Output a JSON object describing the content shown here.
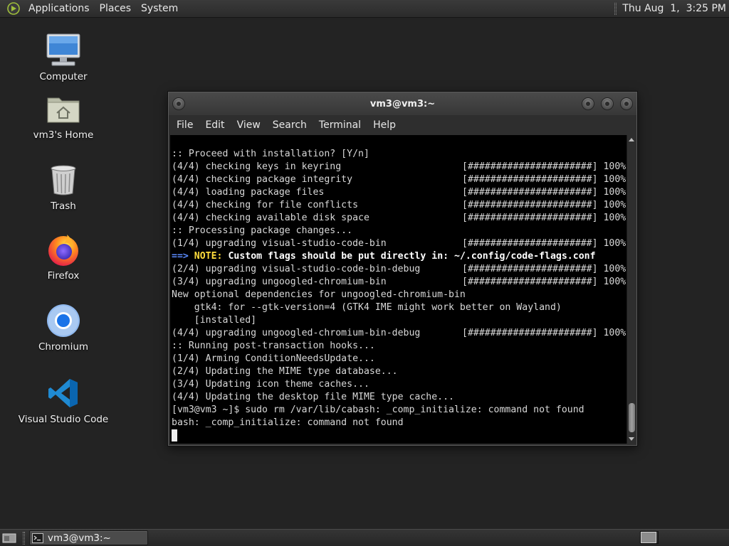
{
  "top_panel": {
    "menus": [
      "Applications",
      "Places",
      "System"
    ],
    "clock": "Thu Aug  1,  3:25 PM"
  },
  "desktop_icons": [
    {
      "label": "Computer",
      "icon": "computer-icon"
    },
    {
      "label": "vm3's Home",
      "icon": "home-folder-icon"
    },
    {
      "label": "Trash",
      "icon": "trash-icon"
    },
    {
      "label": "Firefox",
      "icon": "firefox-icon"
    },
    {
      "label": "Chromium",
      "icon": "chromium-icon"
    },
    {
      "label": "Visual Studio Code",
      "icon": "vscode-icon"
    }
  ],
  "terminal": {
    "title": "vm3@vm3:~",
    "menu": [
      "File",
      "Edit",
      "View",
      "Search",
      "Terminal",
      "Help"
    ],
    "progress_bar": "[######################] 100%",
    "lines": {
      "l01": ":: Proceed with installation? [Y/n]",
      "l02": "(4/4) checking keys in keyring",
      "l03": "(4/4) checking package integrity",
      "l04": "(4/4) loading package files",
      "l05": "(4/4) checking for file conflicts",
      "l06": "(4/4) checking available disk space",
      "l07": ":: Processing package changes...",
      "l08": "(1/4) upgrading visual-studio-code-bin",
      "l09_arrow": "==>",
      "l09_note": "NOTE:",
      "l09_msg": "Custom flags should be put directly in: ~/.config/code-flags.conf",
      "l10": "(2/4) upgrading visual-studio-code-bin-debug",
      "l11": "(3/4) upgrading ungoogled-chromium-bin",
      "l12": "New optional dependencies for ungoogled-chromium-bin",
      "l13": "    gtk4: for --gtk-version=4 (GTK4 IME might work better on Wayland)",
      "l14": "    [installed]",
      "l15": "(4/4) upgrading ungoogled-chromium-bin-debug",
      "l16": ":: Running post-transaction hooks...",
      "l17": "(1/4) Arming ConditionNeedsUpdate...",
      "l18": "(2/4) Updating the MIME type database...",
      "l19": "(3/4) Updating icon theme caches...",
      "l20": "(4/4) Updating the desktop file MIME type cache...",
      "l21": "[vm3@vm3 ~]$ sudo rm /var/lib/cabash: _comp_initialize: command not found",
      "l22": "bash: _comp_initialize: command not found"
    }
  },
  "taskbar": {
    "window_button": "vm3@vm3:~"
  }
}
